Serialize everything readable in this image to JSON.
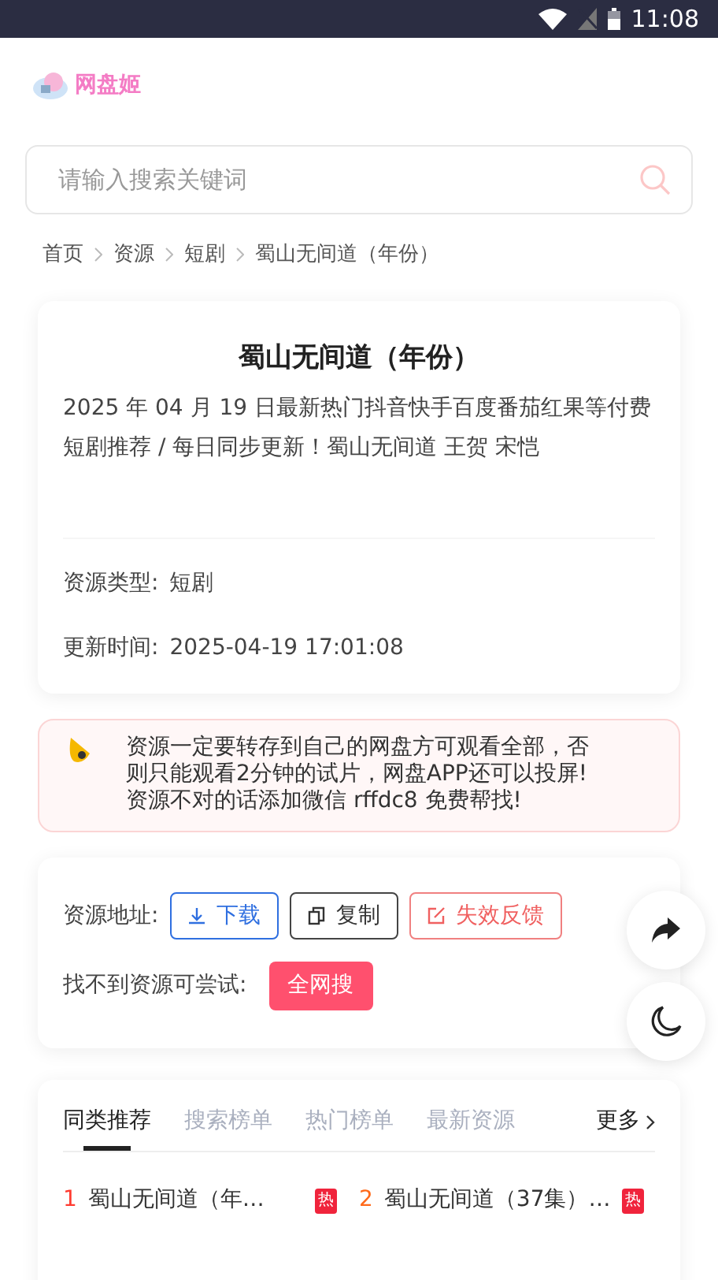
{
  "status_bar": {
    "time": "11:08"
  },
  "logo": {
    "text": "网盘姬"
  },
  "search": {
    "placeholder": "请输入搜索关键词"
  },
  "breadcrumb": [
    "首页",
    "资源",
    "短剧",
    "蜀山无间道（年份）"
  ],
  "resource": {
    "title": "蜀山无间道（年份）",
    "description": "2025 年 04 月 19 日最新热门抖音快手百度番茄红果等付费短剧推荐 / 每日同步更新！蜀山无间道 王贺 宋恺",
    "fields": [
      {
        "label": "资源类型:",
        "value": "短剧"
      },
      {
        "label": "更新时间:",
        "value": "2025-04-19 17:01:08"
      }
    ]
  },
  "notice": {
    "lines": [
      "资源一定要转存到自己的网盘方可观看全部，否",
      "则只能观看2分钟的试片，网盘APP还可以投屏!",
      "资源不对的话添加微信 rffdc8 免费帮找!"
    ]
  },
  "actions": {
    "address_label": "资源地址:",
    "buttons": [
      {
        "kind": "download",
        "label": "下载"
      },
      {
        "kind": "copy",
        "label": "复制"
      },
      {
        "kind": "report",
        "label": "失效反馈"
      }
    ],
    "fallback_label": "找不到资源可尝试:",
    "fallback_button": "全网搜"
  },
  "tabs": [
    {
      "label": "同类推荐",
      "selected": true
    },
    {
      "label": "搜索榜单",
      "selected": false
    },
    {
      "label": "热门榜单",
      "selected": false
    },
    {
      "label": "最新资源",
      "selected": false
    }
  ],
  "more": "更多",
  "list": [
    {
      "rank": "1",
      "color": "#ff3b30",
      "title": "蜀山无间道（年…",
      "badge": "热"
    },
    {
      "rank": "2",
      "color": "#ff6a1a",
      "title": "蜀山无间道（37集）…",
      "badge": "热"
    }
  ]
}
